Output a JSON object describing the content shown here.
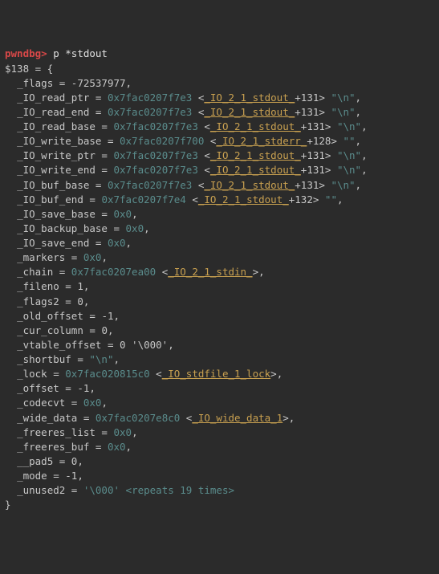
{
  "prompt": "pwndbg>",
  "command": "p *stdout",
  "var": "$138 = {",
  "fields": {
    "flags": {
      "name": "_flags",
      "val": "-72537977"
    },
    "ioreadptr": {
      "name": "_IO_read_ptr",
      "addr": "0x7fac0207f7e3",
      "sym": "_IO_2_1_stdout_",
      "off": "+131",
      "str": "\"\\n\""
    },
    "ioreadend": {
      "name": "_IO_read_end",
      "addr": "0x7fac0207f7e3",
      "sym": "_IO_2_1_stdout_",
      "off": "+131",
      "str": "\"\\n\""
    },
    "ioreadbase": {
      "name": "_IO_read_base",
      "addr": "0x7fac0207f7e3",
      "sym": "_IO_2_1_stdout_",
      "off": "+131",
      "str": "\"\\n\""
    },
    "iowritebase": {
      "name": "_IO_write_base",
      "addr": "0x7fac0207f700",
      "sym": "_IO_2_1_stderr_",
      "off": "+128",
      "str": "\"\""
    },
    "iowriteptr": {
      "name": "_IO_write_ptr",
      "addr": "0x7fac0207f7e3",
      "sym": "_IO_2_1_stdout_",
      "off": "+131",
      "str": "\"\\n\""
    },
    "iowriteend": {
      "name": "_IO_write_end",
      "addr": "0x7fac0207f7e3",
      "sym": "_IO_2_1_stdout_",
      "off": "+131",
      "str": "\"\\n\""
    },
    "iobufbase": {
      "name": "_IO_buf_base",
      "addr": "0x7fac0207f7e3",
      "sym": "_IO_2_1_stdout_",
      "off": "+131",
      "str": "\"\\n\""
    },
    "iobufend": {
      "name": "_IO_buf_end",
      "addr": "0x7fac0207f7e4",
      "sym": "_IO_2_1_stdout_",
      "off": "+132",
      "str": "\"\""
    },
    "iosavebase": {
      "name": "_IO_save_base",
      "val": "0x0"
    },
    "iobackupbase": {
      "name": "_IO_backup_base",
      "val": "0x0"
    },
    "iosaveend": {
      "name": "_IO_save_end",
      "val": "0x0"
    },
    "markers": {
      "name": "_markers",
      "val": "0x0"
    },
    "chain": {
      "name": "_chain",
      "addr": "0x7fac0207ea00",
      "sym": "_IO_2_1_stdin_"
    },
    "fileno": {
      "name": "_fileno",
      "val": "1"
    },
    "flags2": {
      "name": "_flags2",
      "val": "0"
    },
    "oldoffset": {
      "name": "_old_offset",
      "val": "-1"
    },
    "curcolumn": {
      "name": "_cur_column",
      "val": "0"
    },
    "vtableoffset": {
      "name": "_vtable_offset",
      "val": "0 '\\000'"
    },
    "shortbuf": {
      "name": "_shortbuf",
      "val": "\"\\n\""
    },
    "lock": {
      "name": "_lock",
      "addr": "0x7fac020815c0",
      "sym": "_IO_stdfile_1_lock"
    },
    "offset": {
      "name": "_offset",
      "val": "-1"
    },
    "codecvt": {
      "name": "_codecvt",
      "val": "0x0"
    },
    "widedata": {
      "name": "_wide_data",
      "addr": "0x7fac0207e8c0",
      "sym": "_IO_wide_data_1"
    },
    "freereslist": {
      "name": "_freeres_list",
      "val": "0x0"
    },
    "freeresbuf": {
      "name": "_freeres_buf",
      "val": "0x0"
    },
    "pad5": {
      "name": "__pad5",
      "val": "0"
    },
    "mode": {
      "name": "_mode",
      "val": "-1"
    },
    "unused2": {
      "name": "_unused2",
      "val": "'\\000' <repeats 19 times>"
    }
  },
  "close": "}"
}
